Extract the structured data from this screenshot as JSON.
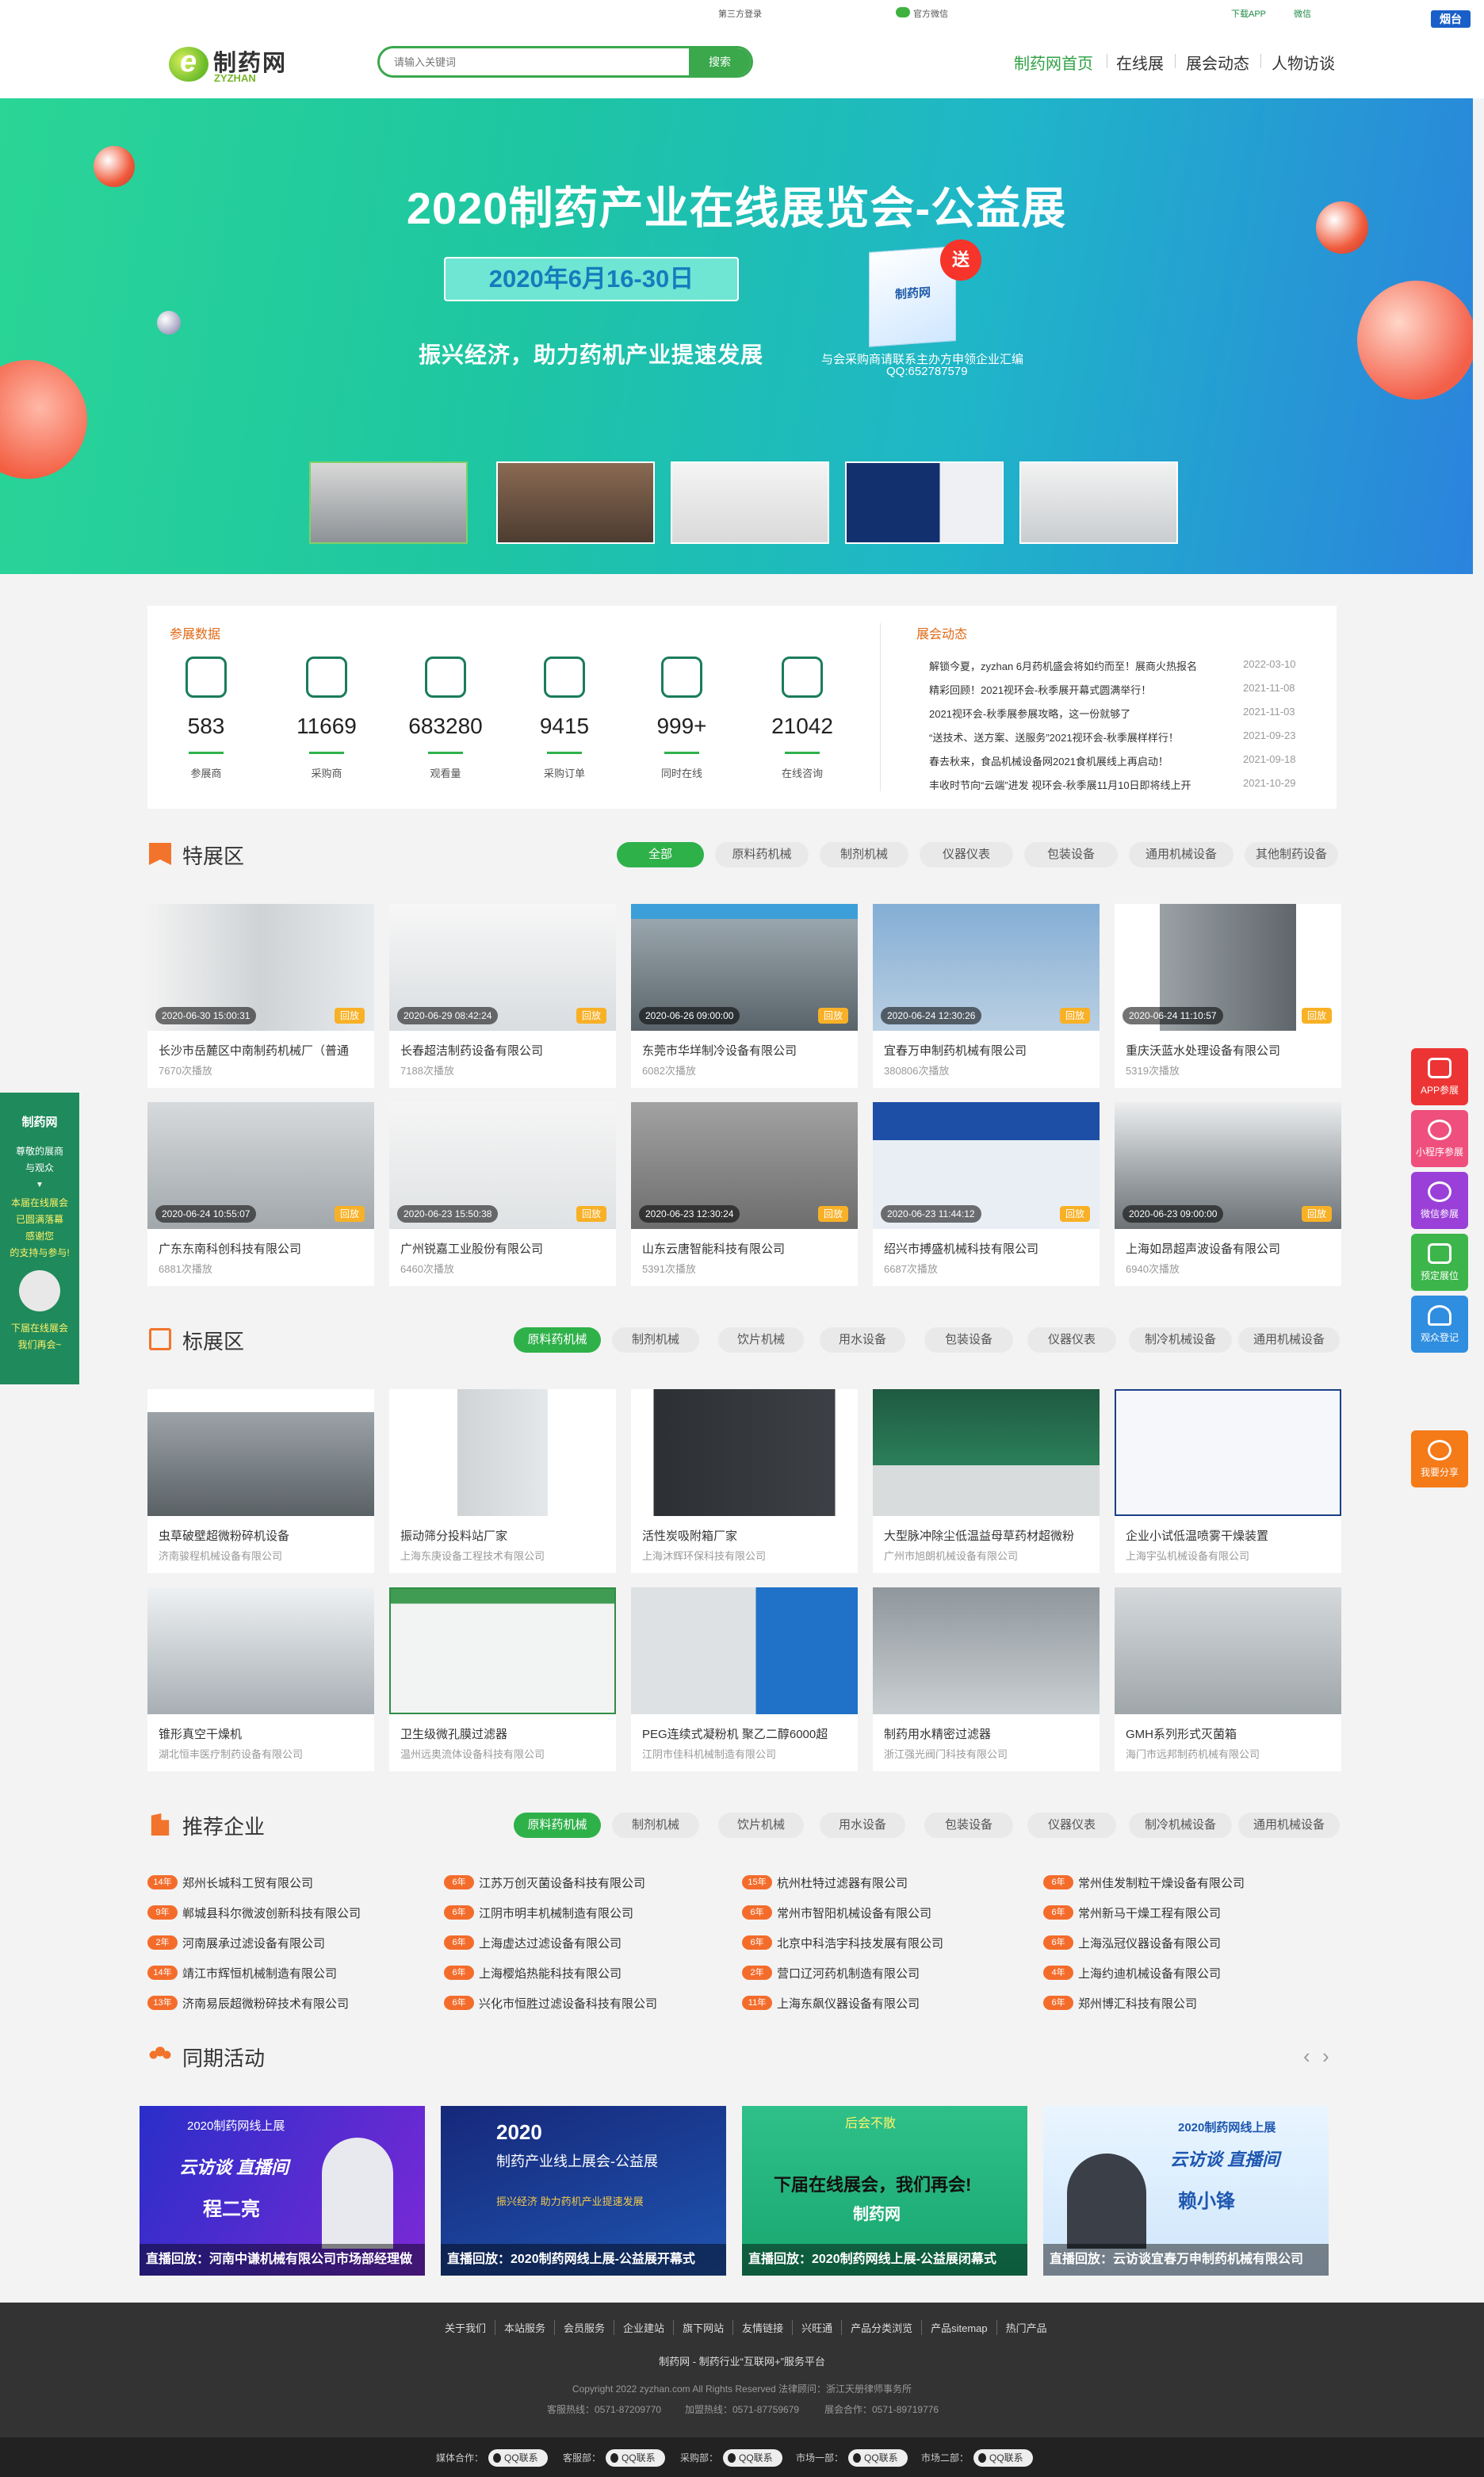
{
  "topbar": {
    "link1": "第三方登录",
    "link2": "官方微信",
    "link3": "下载APP",
    "link4": "微信",
    "city": "烟台"
  },
  "header": {
    "logo_cn": "制药网",
    "logo_en": "ZYZHAN",
    "search_placeholder": "请输入关键词",
    "search_button": "搜索",
    "nav": [
      "制药网首页",
      "在线展",
      "展会动态",
      "人物访谈"
    ]
  },
  "banner": {
    "title": "2020制药产业在线展览会-公益展",
    "date": "2020年6月16-30日",
    "slogan": "振兴经济，助力药机产业提速发展",
    "book_label": "制药网",
    "send": "送",
    "promo1": "与会采购商请联系主办方申领企业汇编",
    "promo2": "QQ:652787579"
  },
  "stats": {
    "title": "参展数据",
    "items": [
      {
        "num": "583",
        "label": "参展商",
        "icon": "user-icon"
      },
      {
        "num": "11669",
        "label": "采购商",
        "icon": "cart-icon"
      },
      {
        "num": "683280",
        "label": "观看量",
        "icon": "group-icon"
      },
      {
        "num": "9415",
        "label": "采购订单",
        "icon": "chat-icon"
      },
      {
        "num": "999+",
        "label": "同时在线",
        "icon": "service-icon"
      },
      {
        "num": "21042",
        "label": "在线咨询",
        "icon": "clipboard-icon"
      }
    ]
  },
  "news": {
    "title": "展会动态",
    "items": [
      {
        "text": "解锁今夏，zyzhan 6月药机盛会将如约而至！展商火热报名",
        "date": "2022-03-10"
      },
      {
        "text": "精彩回顾！2021视环会-秋季展开幕式圆满举行！",
        "date": "2021-11-08"
      },
      {
        "text": "2021视环会-秋季展参展攻略，这一份就够了",
        "date": "2021-11-03"
      },
      {
        "text": "“送技术、送方案、送服务”2021视环会-秋季展样样行！",
        "date": "2021-09-23"
      },
      {
        "text": "春去秋来，食品机械设备网2021食机展线上再启动！",
        "date": "2021-09-18"
      },
      {
        "text": "丰收时节向“云端”进发 视环会-秋季展11月10日即将线上开",
        "date": "2021-10-29"
      }
    ]
  },
  "special": {
    "title": "特展区",
    "tabs": [
      "全部",
      "原料药机械",
      "制剂机械",
      "仪器仪表",
      "包装设备",
      "通用机械设备",
      "其他制药设备"
    ],
    "replay": "回放",
    "cards": [
      {
        "ts": "2020-06-30 15:00:31",
        "title": "长沙市岳麓区中南制药机械厂（普通",
        "views": "7670次播放"
      },
      {
        "ts": "2020-06-29 08:42:24",
        "title": "长春超洁制药设备有限公司",
        "views": "7188次播放"
      },
      {
        "ts": "2020-06-26 09:00:00",
        "title": "东莞市华垟制冷设备有限公司",
        "views": "6082次播放"
      },
      {
        "ts": "2020-06-24 12:30:26",
        "title": "宜春万申制药机械有限公司",
        "views": "380806次播放"
      },
      {
        "ts": "2020-06-24 11:10:57",
        "title": "重庆沃蓝水处理设备有限公司",
        "views": "5319次播放"
      },
      {
        "ts": "2020-06-24 10:55:07",
        "title": "广东东南科创科技有限公司",
        "views": "6881次播放"
      },
      {
        "ts": "2020-06-23 15:50:38",
        "title": "广州锐嘉工业股份有限公司",
        "views": "6460次播放"
      },
      {
        "ts": "2020-06-23 12:30:24",
        "title": "山东云唐智能科技有限公司",
        "views": "5391次播放"
      },
      {
        "ts": "2020-06-23 11:44:12",
        "title": "绍兴市搏盛机械科技有限公司",
        "views": "6687次播放"
      },
      {
        "ts": "2020-06-23 09:00:00",
        "title": "上海如昂超声波设备有限公司",
        "views": "6940次播放"
      }
    ]
  },
  "standard": {
    "title": "标展区",
    "tabs": [
      "原料药机械",
      "制剂机械",
      "饮片机械",
      "用水设备",
      "包装设备",
      "仪器仪表",
      "制冷机械设备",
      "通用机械设备"
    ],
    "cards": [
      {
        "title": "虫草破壁超微粉碎机设备",
        "company": "济南骏程机械设备有限公司"
      },
      {
        "title": "振动筛分投料站厂家",
        "company": "上海东庚设备工程技术有限公司"
      },
      {
        "title": "活性炭吸附箱厂家",
        "company": "上海沐辉环保科技有限公司"
      },
      {
        "title": "大型脉冲除尘低温益母草药材超微粉",
        "company": "广州市旭朗机械设备有限公司"
      },
      {
        "title": "企业小试低温喷雾干燥装置",
        "company": "上海宇弘机械设备有限公司"
      },
      {
        "title": "锥形真空干燥机",
        "company": "湖北恒丰医疗制药设备有限公司"
      },
      {
        "title": "卫生级微孔膜过滤器",
        "company": "温州远奥流体设备科技有限公司"
      },
      {
        "title": "PEG连续式凝粉机 聚乙二醇6000超",
        "company": "江阴市佳科机械制造有限公司"
      },
      {
        "title": "制药用水精密过滤器",
        "company": "浙江强光阀门科技有限公司"
      },
      {
        "title": "GMH系列形式灭菌箱",
        "company": "海门市远邦制药机械有限公司"
      }
    ]
  },
  "recommend": {
    "title": "推荐企业",
    "tabs": [
      "原料药机械",
      "制剂机械",
      "饮片机械",
      "用水设备",
      "包装设备",
      "仪器仪表",
      "制冷机械设备",
      "通用机械设备"
    ],
    "rows": [
      [
        {
          "y": "14年",
          "n": "郑州长城科工贸有限公司"
        },
        {
          "y": "6年",
          "n": "江苏万创灭菌设备科技有限公司"
        },
        {
          "y": "15年",
          "n": "杭州杜特过滤器有限公司"
        },
        {
          "y": "6年",
          "n": "常州佳发制粒干燥设备有限公司"
        }
      ],
      [
        {
          "y": "9年",
          "n": "郸城县科尔微波创新科技有限公司"
        },
        {
          "y": "6年",
          "n": "江阴市明丰机械制造有限公司"
        },
        {
          "y": "6年",
          "n": "常州市智阳机械设备有限公司"
        },
        {
          "y": "6年",
          "n": "常州新马干燥工程有限公司"
        }
      ],
      [
        {
          "y": "2年",
          "n": "河南展承过滤设备有限公司"
        },
        {
          "y": "6年",
          "n": "上海虚达过滤设备有限公司"
        },
        {
          "y": "6年",
          "n": "北京中科浩宇科技发展有限公司"
        },
        {
          "y": "6年",
          "n": "上海泓冠仪器设备有限公司"
        }
      ],
      [
        {
          "y": "14年",
          "n": "靖江市辉恒机械制造有限公司"
        },
        {
          "y": "6年",
          "n": "上海樱焰热能科技有限公司"
        },
        {
          "y": "2年",
          "n": "营口辽河药机制造有限公司"
        },
        {
          "y": "4年",
          "n": "上海约迪机械设备有限公司"
        }
      ],
      [
        {
          "y": "13年",
          "n": "济南易辰超微粉碎技术有限公司"
        },
        {
          "y": "6年",
          "n": "兴化市恒胜过滤设备科技有限公司"
        },
        {
          "y": "11年",
          "n": "上海东飙仪器设备有限公司"
        },
        {
          "y": "6年",
          "n": "郑州博汇科技有限公司"
        }
      ]
    ]
  },
  "activities": {
    "title": "同期活动",
    "items": [
      {
        "cap": "直播回放：河南中谦机械有限公司市场部经理做",
        "tag": "云访谈 直播间",
        "name": "程二亮",
        "brand": "2020制药网线上展"
      },
      {
        "cap": "直播回放：2020制药网线上展-公益展开幕式",
        "tag": "2020",
        "name": "制药产业线上展会-公益展",
        "brand": "振兴经济 助力药机产业提速发展"
      },
      {
        "cap": "直播回放：2020制药网线上展-公益展闭幕式",
        "tag": "后会不散",
        "name": "下届在线展会，我们再会!",
        "brand": "制药网"
      },
      {
        "cap": "直播回放：云访谈宜春万申制药机械有限公司",
        "tag": "云访谈 直播间",
        "name": "赖小锋",
        "brand": "2020制药网线上展"
      }
    ]
  },
  "footer": {
    "links": [
      "关于我们",
      "本站服务",
      "会员服务",
      "企业建站",
      "旗下网站",
      "友情链接",
      "兴旺通",
      "产品分类浏览",
      "产品sitemap",
      "热门产品"
    ],
    "slogan": "制药网 - 制药行业“互联网+”服务平台",
    "copyright": "Copyright 2022 zyzhan.com    All Rights Reserved    法律顾问：浙江天册律师事务所",
    "hotline1": "客服热线：0571-87209770",
    "hotline2": "加盟热线：0571-87759679",
    "hotline3": "展会合作：0571-89719776",
    "qq": [
      {
        "label": "媒体合作：",
        "btn": "QQ联系"
      },
      {
        "label": "客服部：",
        "btn": "QQ联系"
      },
      {
        "label": "采购部：",
        "btn": "QQ联系"
      },
      {
        "label": "市场一部：",
        "btn": "QQ联系"
      },
      {
        "label": "市场二部：",
        "btn": "QQ联系"
      }
    ]
  },
  "leftfloat": {
    "brand": "制药网",
    "l1": "尊敬的展商",
    "l2": "与观众",
    "l3": "本届在线展会",
    "l4": "已圆满落幕",
    "l5": "感谢您",
    "l6": "的支持与参与!",
    "l7": "下届在线展会",
    "l8": "我们再会~"
  },
  "rightfloat": [
    "APP参展",
    "小程序参展",
    "微信参展",
    "预定展位",
    "观众登记",
    "我要分享"
  ],
  "colors": {
    "green": "#2fb14a",
    "orange": "#e06a17",
    "dark": "#333333"
  }
}
